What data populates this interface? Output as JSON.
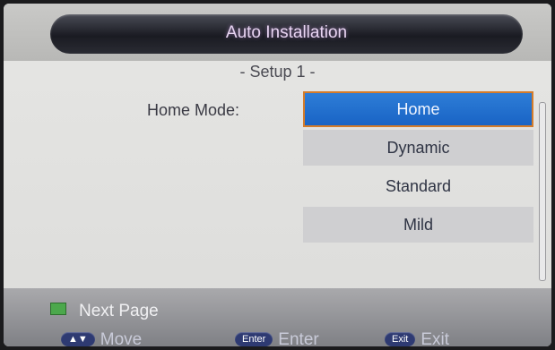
{
  "window": {
    "title": "Auto Installation"
  },
  "setup": {
    "subtitle": "- Setup 1 -",
    "field_label": "Home Mode:",
    "options": [
      {
        "label": "Home",
        "state": "selected"
      },
      {
        "label": "Dynamic",
        "state": "normal"
      },
      {
        "label": "Standard",
        "state": "normal"
      },
      {
        "label": "Mild",
        "state": "normal"
      }
    ]
  },
  "footer": {
    "next_page_label": "Next Page",
    "next_page_key_color": "#4ca84c",
    "help": [
      {
        "key": "▲▼",
        "label": "Move"
      },
      {
        "key": "Enter",
        "label": "Enter"
      },
      {
        "key": "Exit",
        "label": "Exit"
      }
    ]
  },
  "colors": {
    "selected_highlight": "#1f6fd0",
    "selection_border": "#d47c2a",
    "title_bar": "#1a1b22",
    "key_pill": "#2e3a72"
  }
}
